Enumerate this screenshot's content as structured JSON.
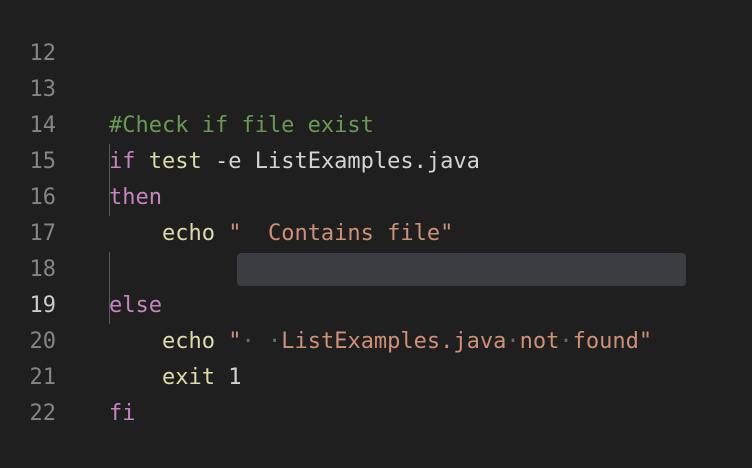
{
  "lines": [
    {
      "num": "12"
    },
    {
      "num": "13",
      "comment": "#Check if file exist"
    },
    {
      "num": "14",
      "kw": "if",
      "cmd": "test",
      "args": " -e ListExamples.java"
    },
    {
      "num": "15",
      "kw": "then"
    },
    {
      "num": "16",
      "cmd": "echo",
      "str": "\"  Contains file\""
    },
    {
      "num": "17"
    },
    {
      "num": "18",
      "kw": "else"
    },
    {
      "num": "19",
      "cmd": "echo",
      "str_parts": [
        "\"",
        "·",
        " ",
        "·",
        "ListExamples.java",
        "·",
        "not",
        "·",
        "found\""
      ]
    },
    {
      "num": "20",
      "cmd": "exit",
      "arg": "1"
    },
    {
      "num": "21",
      "kw": "fi"
    },
    {
      "num": "22"
    }
  ],
  "colors": {
    "background": "#1f1f1f",
    "keyword": "#c586c0",
    "function": "#dcdcaa",
    "string": "#ce9178",
    "comment": "#6a9955",
    "line_number": "#858585",
    "selection": "#3a3d41"
  }
}
